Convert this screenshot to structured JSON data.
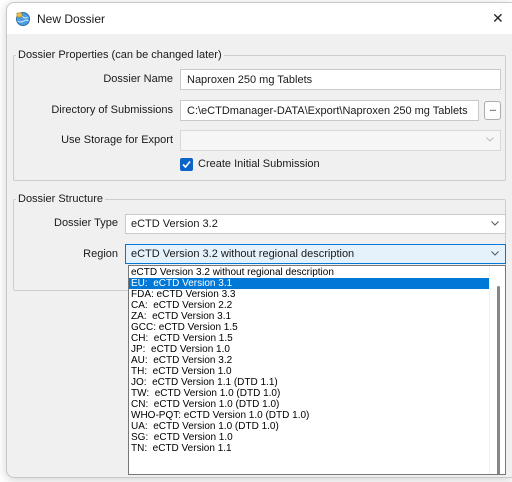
{
  "window": {
    "title": "New Dossier",
    "close_glyph": "✕"
  },
  "properties": {
    "legend": "Dossier Properties (can be changed later)",
    "dossier_name_label": "Dossier Name",
    "dossier_name_value": "Naproxen 250 mg Tablets",
    "directory_label": "Directory of Submissions",
    "directory_value": "C:\\eCTDmanager-DATA\\Export\\Naproxen 250 mg Tablets",
    "browse_label": "...",
    "storage_label": "Use Storage for Export",
    "storage_value": "",
    "create_initial_label": "Create Initial Submission",
    "create_initial_checked": true
  },
  "structure": {
    "legend": "Dossier Structure",
    "type_label": "Dossier Type",
    "type_value": "eCTD Version 3.2",
    "region_label": "Region",
    "region_value": "eCTD Version 3.2 without regional description"
  },
  "dropdown": {
    "selected_index": 1,
    "options": [
      "eCTD Version 3.2 without regional description",
      "EU:  eCTD Version 3.1",
      "FDA: eCTD Version 3.3",
      "CA:  eCTD Version 2.2",
      "ZA:  eCTD Version 3.1",
      "GCC: eCTD Version 1.5",
      "CH:  eCTD Version 1.5",
      "JP:  eCTD Version 1.0",
      "AU:  eCTD Version 3.2",
      "TH:  eCTD Version 1.0",
      "JO:  eCTD Version 1.1 (DTD 1.1)",
      "TW:  eCTD Version 1.0 (DTD 1.0)",
      "CN:  eCTD Version 1.0 (DTD 1.0)",
      "WHO-PQT: eCTD Version 1.0 (DTD 1.0)",
      "UA:  eCTD Version 1.0 (DTD 1.0)",
      "SG:  eCTD Version 1.0",
      "TN:  eCTD Version 1.1"
    ]
  },
  "colors": {
    "accent": "#0078d7",
    "checkbox": "#0a63c8",
    "window_bg": "#f0f0f0"
  },
  "icons": {
    "app": "dossier-globe-icon",
    "close": "close-icon",
    "chevron": "chevron-down-icon",
    "check": "checkmark-icon"
  }
}
